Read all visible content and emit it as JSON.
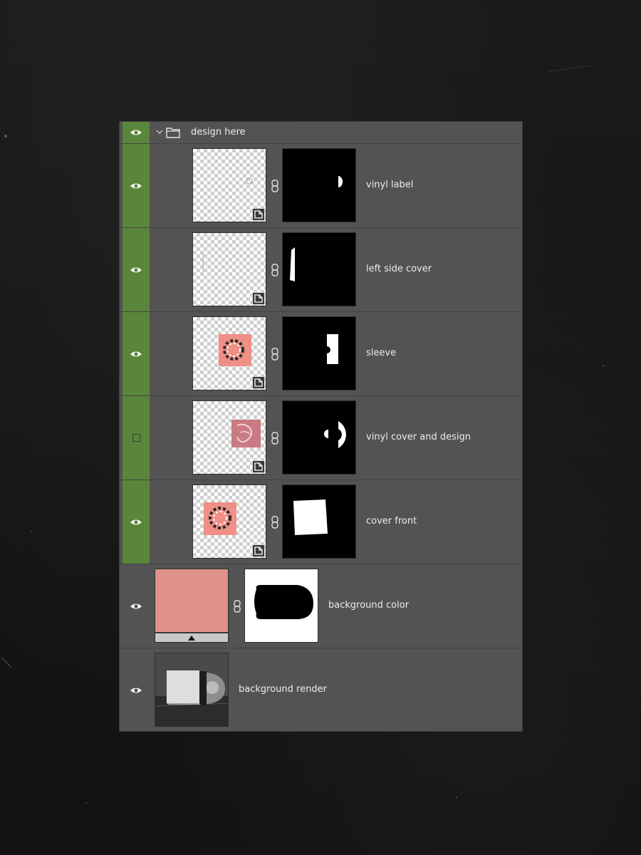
{
  "group": {
    "name": "design here",
    "visible": true,
    "expanded": true
  },
  "layers": [
    {
      "name": "vinyl label",
      "visible": true,
      "kind": "smart-object",
      "linked_mask": true
    },
    {
      "name": "left side cover",
      "visible": true,
      "kind": "smart-object",
      "linked_mask": true
    },
    {
      "name": "sleeve",
      "visible": true,
      "kind": "smart-object",
      "linked_mask": true
    },
    {
      "name": "vinyl cover and design",
      "visible": false,
      "kind": "smart-object",
      "linked_mask": true
    },
    {
      "name": "cover front",
      "visible": true,
      "kind": "smart-object",
      "linked_mask": true
    },
    {
      "name": "background color",
      "visible": true,
      "kind": "fill",
      "linked_mask": true,
      "fill_color": "#e0918a"
    },
    {
      "name": "background render",
      "visible": true,
      "kind": "image"
    }
  ],
  "colors": {
    "panel_bg": "#535353",
    "visibility_highlight": "#5a863b",
    "text": "#ececec",
    "accent_pink": "#ef8f86"
  },
  "icons": [
    "eye-icon",
    "visibility-off-box",
    "chevron-down-icon",
    "folder-icon",
    "chain-link-icon",
    "smart-object-badge-icon"
  ]
}
